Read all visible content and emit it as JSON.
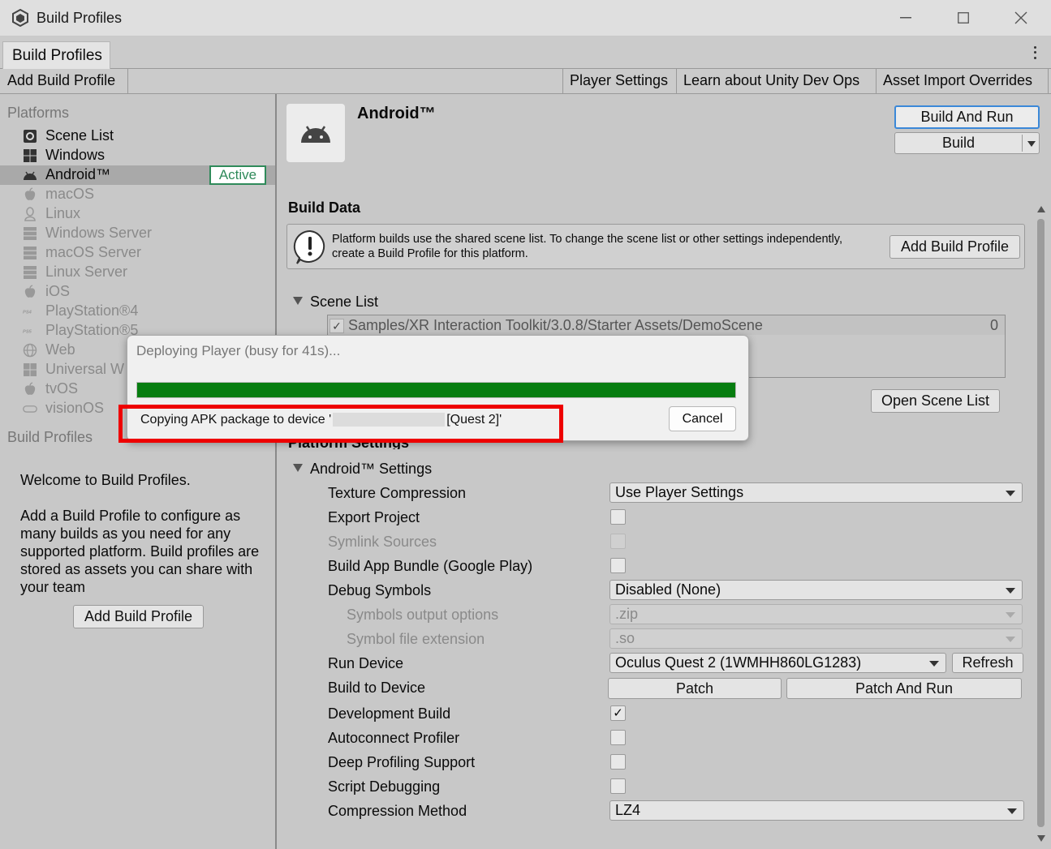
{
  "window": {
    "title": "Build Profiles"
  },
  "tabs": [
    {
      "label": "Build Profiles"
    }
  ],
  "toolbar": {
    "add_build_profile": "Add Build Profile",
    "player_settings": "Player Settings",
    "learn_dev_ops": "Learn about Unity Dev Ops",
    "asset_import_overrides": "Asset Import Overrides"
  },
  "sidebar": {
    "platforms_heading": "Platforms",
    "platforms": [
      {
        "label": "Scene List",
        "icon": "scene-list-icon"
      },
      {
        "label": "Windows",
        "icon": "windows-icon"
      },
      {
        "label": "Android™",
        "icon": "android-icon",
        "selected": true,
        "badge": "Active"
      },
      {
        "label": "macOS",
        "icon": "apple-icon"
      },
      {
        "label": "Linux",
        "icon": "linux-icon"
      },
      {
        "label": "Windows Server",
        "icon": "server-icon"
      },
      {
        "label": "macOS Server",
        "icon": "server-icon"
      },
      {
        "label": "Linux Server",
        "icon": "server-icon"
      },
      {
        "label": "iOS",
        "icon": "apple-icon"
      },
      {
        "label": "PlayStation®4",
        "icon": "ps4-icon"
      },
      {
        "label": "PlayStation®5",
        "icon": "ps5-icon"
      },
      {
        "label": "Web",
        "icon": "globe-icon"
      },
      {
        "label": "Universal W",
        "icon": "windows-icon"
      },
      {
        "label": "tvOS",
        "icon": "apple-icon"
      },
      {
        "label": "visionOS",
        "icon": "visionos-icon"
      }
    ],
    "build_profiles_heading": "Build Profiles",
    "welcome_title": "Welcome to Build Profiles.",
    "welcome_body": "Add a Build Profile to configure as many builds as you need for any supported platform. Build profiles are stored as assets you can share with your team",
    "add_build_profile": "Add Build Profile"
  },
  "main": {
    "platform_name": "Android™",
    "build_and_run": "Build And Run",
    "build": "Build",
    "build_data_heading": "Build Data",
    "info_text": "Platform builds use the shared scene list. To change the scene list or other settings independently, create a Build Profile for this platform.",
    "info_add_build_profile": "Add Build Profile",
    "scene_list_label": "Scene List",
    "scenes": [
      {
        "name": "Samples/XR Interaction Toolkit/3.0.8/Starter Assets/DemoScene",
        "index": "0",
        "checked": true
      }
    ],
    "open_scene_list": "Open Scene List",
    "platform_settings_heading": "Platform Settings",
    "android_settings_label": "Android™ Settings",
    "settings": {
      "texture_compression": {
        "label": "Texture Compression",
        "value": "Use Player Settings"
      },
      "export_project": {
        "label": "Export Project",
        "checked": false
      },
      "symlink_sources": {
        "label": "Symlink Sources",
        "checked": false,
        "disabled": true
      },
      "build_app_bundle": {
        "label": "Build App Bundle (Google Play)",
        "checked": false
      },
      "debug_symbols": {
        "label": "Debug Symbols",
        "value": "Disabled (None)"
      },
      "symbols_output": {
        "label": "Symbols output options",
        "value": ".zip",
        "disabled": true
      },
      "symbol_file_ext": {
        "label": "Symbol file extension",
        "value": ".so",
        "disabled": true
      },
      "run_device": {
        "label": "Run Device",
        "value": "Oculus Quest 2 (1WMHH860LG1283)",
        "refresh": "Refresh"
      },
      "build_to_device": {
        "label": "Build to Device",
        "patch": "Patch",
        "patch_and_run": "Patch And Run"
      },
      "development_build": {
        "label": "Development Build",
        "checked": true
      },
      "autoconnect_profiler": {
        "label": "Autoconnect Profiler",
        "checked": false
      },
      "deep_profiling": {
        "label": "Deep Profiling Support",
        "checked": false
      },
      "script_debugging": {
        "label": "Script Debugging",
        "checked": false
      },
      "compression_method": {
        "label": "Compression Method",
        "value": "LZ4"
      }
    }
  },
  "dialog": {
    "title": "Deploying Player (busy for 41s)...",
    "progress": 1.0,
    "message_prefix": "Copying APK package to device '",
    "message_suffix": "[Quest 2]'",
    "cancel": "Cancel",
    "progress_color": "#077d10",
    "highlight_color": "#ee0000"
  }
}
